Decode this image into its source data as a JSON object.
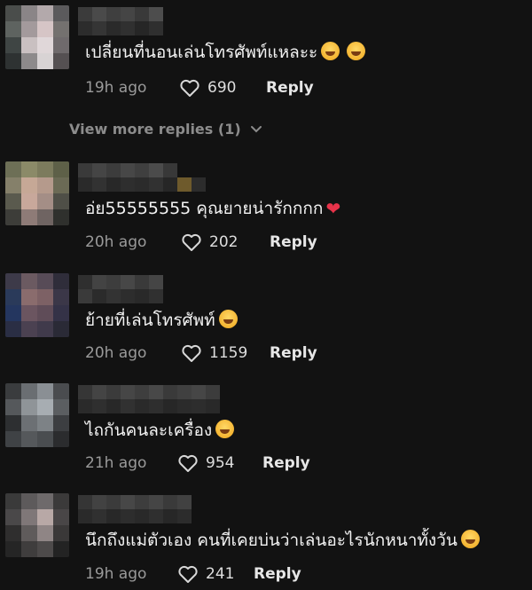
{
  "comments": [
    {
      "text": "เปลี่ยนที่นอนเล่นโทรศัพท์แหละะ",
      "emojis": [
        "face-with-tears-of-joy",
        "face-with-tears-of-joy"
      ],
      "time": "19h ago",
      "likes": "690",
      "reply": "Reply"
    },
    {
      "text": "อ่ย55555555 คุณยายน่ารักกกก",
      "emojis": [
        "heart-with-ribbon"
      ],
      "time": "20h ago",
      "likes": "202",
      "reply": "Reply"
    },
    {
      "text": "ย้ายที่เล่นโทรศัพท์",
      "emojis": [
        "grinning-face-with-sweat"
      ],
      "time": "20h ago",
      "likes": "1159",
      "reply": "Reply"
    },
    {
      "text": "ไถกันคนละเครื่อง",
      "emojis": [
        "grinning-face-with-sweat"
      ],
      "time": "21h ago",
      "likes": "954",
      "reply": "Reply"
    },
    {
      "text": "นึกถึงแม่ตัวเอง คนที่เคยบ่นว่าเล่นอะไรนักหนาทั้งวัน",
      "emojis": [
        "face-with-tears-of-joy"
      ],
      "time": "19h ago",
      "likes": "241",
      "reply": "Reply"
    }
  ],
  "view_more_replies": "View more replies (1)",
  "colors": {
    "background": "#121212",
    "text": "#f2f2f2",
    "meta": "#9a9a9a"
  }
}
